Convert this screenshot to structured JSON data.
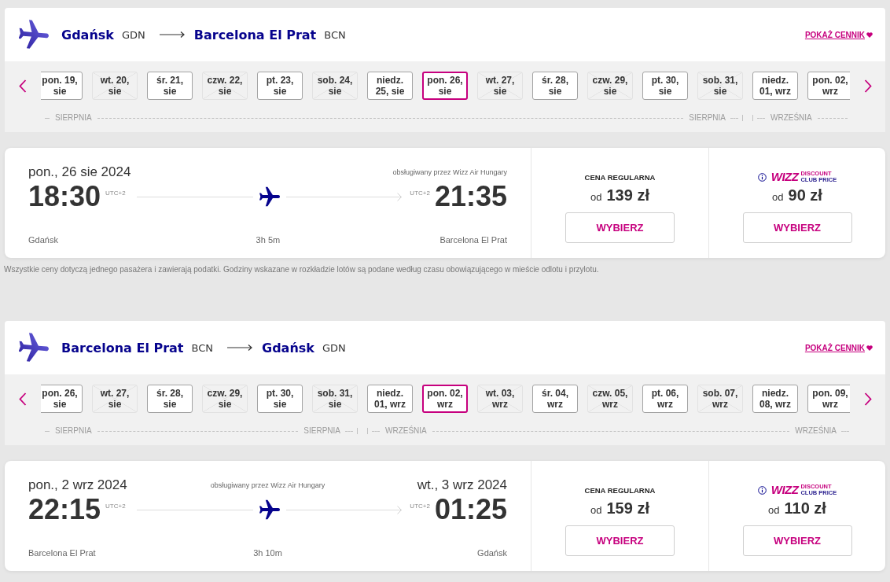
{
  "legs": [
    {
      "header": {
        "from_city": "Gdańsk",
        "from_code": "GDN",
        "to_city": "Barcelona El Prat",
        "to_code": "BCN",
        "price_link": "POKAŻ CENNIK"
      },
      "months": [
        {
          "labels": [
            "SIERPNIA",
            "SIERPNIA"
          ],
          "dates": [
            {
              "label": "pon. 19,\nsie",
              "available": true,
              "selected": false
            },
            {
              "label": "wt. 20,\nsie",
              "available": false,
              "selected": false
            },
            {
              "label": "śr. 21,\nsie",
              "available": true,
              "selected": false
            },
            {
              "label": "czw. 22,\nsie",
              "available": false,
              "selected": false
            },
            {
              "label": "pt. 23,\nsie",
              "available": true,
              "selected": false
            },
            {
              "label": "sob. 24,\nsie",
              "available": false,
              "selected": false
            },
            {
              "label": "niedz.\n25, sie",
              "available": true,
              "selected": false
            },
            {
              "label": "pon. 26,\nsie",
              "available": true,
              "selected": true
            },
            {
              "label": "wt. 27,\nsie",
              "available": false,
              "selected": false
            },
            {
              "label": "śr. 28,\nsie",
              "available": true,
              "selected": false
            },
            {
              "label": "czw. 29,\nsie",
              "available": false,
              "selected": false
            },
            {
              "label": "pt. 30,\nsie",
              "available": true,
              "selected": false
            },
            {
              "label": "sob. 31,\nsie",
              "available": false,
              "selected": false
            }
          ]
        },
        {
          "labels": [
            "WRZEŚNIA"
          ],
          "dates": [
            {
              "label": "niedz.\n01, wrz",
              "available": true,
              "selected": false
            },
            {
              "label": "pon. 02,\nwrz",
              "available": true,
              "selected": false
            }
          ]
        }
      ],
      "flight": {
        "departure_date": "pon., 26 sie 2024",
        "operator": "obsługiwany przez Wizz Air Hungary",
        "departure_time": "18:30",
        "departure_tz": "UTC+2",
        "duration": "3h 5m",
        "arrival_tz": "UTC+2",
        "arrival_time": "21:35",
        "departure_city": "Gdańsk",
        "arrival_city": "Barcelona El Prat"
      },
      "fares": [
        {
          "kind": "regular",
          "title": "CENA REGULARNA",
          "prefix": "od",
          "price": "139 zł",
          "button": "WYBIERZ"
        },
        {
          "kind": "club",
          "brand": "WIZZ",
          "badge_line_1": "DISCOUNT",
          "badge_line_2": "CLUB PRICE",
          "prefix": "od",
          "price": "90 zł",
          "button": "WYBIERZ"
        }
      ],
      "note": "Wszystkie ceny dotyczą jednego pasażera i zawierają podatki. Godziny wskazane w rozkładzie lotów są podane według czasu obowiązującego w mieście odlotu i przylotu."
    },
    {
      "header": {
        "from_city": "Barcelona El Prat",
        "from_code": "BCN",
        "to_city": "Gdańsk",
        "to_code": "GDN",
        "price_link": "POKAŻ CENNIK"
      },
      "months": [
        {
          "labels": [
            "SIERPNIA",
            "SIERPNIA"
          ],
          "dates": [
            {
              "label": "pon. 26,\nsie",
              "available": true,
              "selected": false
            },
            {
              "label": "wt. 27,\nsie",
              "available": false,
              "selected": false
            },
            {
              "label": "śr. 28,\nsie",
              "available": true,
              "selected": false
            },
            {
              "label": "czw. 29,\nsie",
              "available": false,
              "selected": false
            },
            {
              "label": "pt. 30,\nsie",
              "available": true,
              "selected": false
            },
            {
              "label": "sob. 31,\nsie",
              "available": false,
              "selected": false
            }
          ]
        },
        {
          "labels": [
            "WRZEŚNIA",
            "WRZEŚNIA"
          ],
          "dates": [
            {
              "label": "niedz.\n01, wrz",
              "available": true,
              "selected": false
            },
            {
              "label": "pon. 02,\nwrz",
              "available": true,
              "selected": true
            },
            {
              "label": "wt. 03,\nwrz",
              "available": false,
              "selected": false
            },
            {
              "label": "śr. 04,\nwrz",
              "available": true,
              "selected": false
            },
            {
              "label": "czw. 05,\nwrz",
              "available": false,
              "selected": false
            },
            {
              "label": "pt. 06,\nwrz",
              "available": true,
              "selected": false
            },
            {
              "label": "sob. 07,\nwrz",
              "available": false,
              "selected": false
            },
            {
              "label": "niedz.\n08, wrz",
              "available": true,
              "selected": false
            },
            {
              "label": "pon. 09,\nwrz",
              "available": true,
              "selected": false
            }
          ]
        }
      ],
      "flight": {
        "departure_date": "pon., 2 wrz 2024",
        "operator": "obsługiwany przez Wizz Air Hungary",
        "arrival_date": "wt., 3 wrz 2024",
        "departure_time": "22:15",
        "departure_tz": "UTC+2",
        "duration": "3h 10m",
        "arrival_tz": "UTC+2",
        "arrival_time": "01:25",
        "departure_city": "Barcelona El Prat",
        "arrival_city": "Gdańsk"
      },
      "fares": [
        {
          "kind": "regular",
          "title": "CENA REGULARNA",
          "prefix": "od",
          "price": "159 zł",
          "button": "WYBIERZ"
        },
        {
          "kind": "club",
          "brand": "WIZZ",
          "badge_line_1": "DISCOUNT",
          "badge_line_2": "CLUB PRICE",
          "prefix": "od",
          "price": "110 zł",
          "button": "WYBIERZ"
        }
      ]
    }
  ]
}
